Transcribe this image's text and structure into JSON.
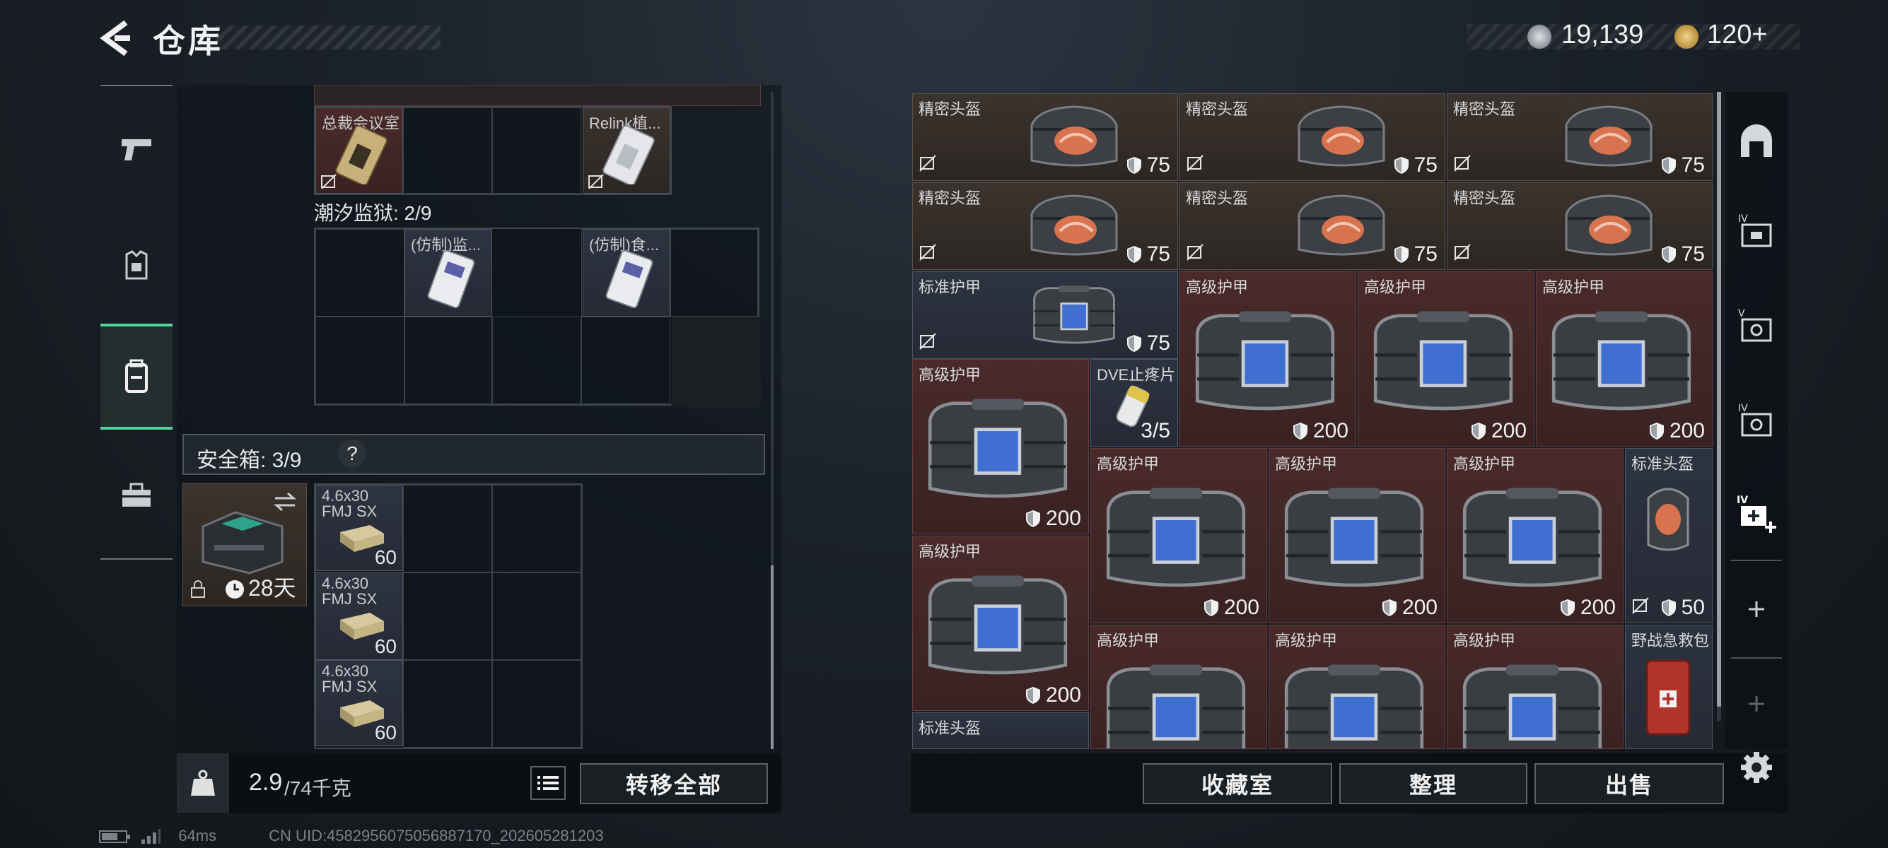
{
  "header": {
    "title": "仓库"
  },
  "currency": [
    {
      "icon": "silver-coin-icon",
      "value": "19,139"
    },
    {
      "icon": "gold-coin-icon",
      "value": "120+"
    }
  ],
  "sidebar": {
    "tabs": [
      {
        "icon": "pistol-icon",
        "active": false
      },
      {
        "icon": "armor-vest-icon",
        "active": false
      },
      {
        "icon": "backpack-icon",
        "active": true
      },
      {
        "icon": "toolbox-icon",
        "active": false
      }
    ]
  },
  "left": {
    "keys_grid": {
      "items": [
        {
          "name": "总裁会议室"
        },
        {
          "name": "Relink植..."
        }
      ]
    },
    "prison_label": "潮汐监狱: 2/9",
    "prison_items": [
      {
        "name": "(仿制)监..."
      },
      {
        "name": "(仿制)食..."
      }
    ],
    "safe_box": {
      "label": "安全箱: 3/9",
      "help": "?",
      "duration": "28天",
      "ammo": [
        {
          "name": "4.6x30 FMJ SX",
          "count": "60"
        },
        {
          "name": "4.6x30 FMJ SX",
          "count": "60"
        },
        {
          "name": "4.6x30 FMJ SX",
          "count": "60"
        }
      ]
    },
    "weight": {
      "current": "2.9",
      "max": "/74千克"
    },
    "transfer_all": "转移全部"
  },
  "right": {
    "items": [
      {
        "name": "精密头盔",
        "durability": "75",
        "tier": "brown"
      },
      {
        "name": "精密头盔",
        "durability": "75",
        "tier": "brown"
      },
      {
        "name": "精密头盔",
        "durability": "75",
        "tier": "brown"
      },
      {
        "name": "精密头盔",
        "durability": "75",
        "tier": "brown"
      },
      {
        "name": "精密头盔",
        "durability": "75",
        "tier": "brown"
      },
      {
        "name": "精密头盔",
        "durability": "75",
        "tier": "brown"
      },
      {
        "name": "标准护甲",
        "durability": "75",
        "tier": "blue"
      },
      {
        "name": "高级护甲",
        "durability": "200",
        "tier": "red"
      },
      {
        "name": "高级护甲",
        "durability": "200",
        "tier": "red"
      },
      {
        "name": "高级护甲",
        "durability": "200",
        "tier": "red"
      },
      {
        "name": "高级护甲",
        "durability": "200",
        "tier": "red"
      },
      {
        "name": "DVE止疼片",
        "durability": "3/5",
        "tier": "blue"
      },
      {
        "name": "高级护甲",
        "durability": "200",
        "tier": "red"
      },
      {
        "name": "高级护甲",
        "durability": "200",
        "tier": "red"
      },
      {
        "name": "高级护甲",
        "durability": "200",
        "tier": "red"
      },
      {
        "name": "标准头盔",
        "durability": "50",
        "tier": "blue"
      },
      {
        "name": "高级护甲",
        "durability": "200",
        "tier": "red"
      },
      {
        "name": "高级护甲",
        "durability": "",
        "tier": "red"
      },
      {
        "name": "高级护甲",
        "durability": "",
        "tier": "red"
      },
      {
        "name": "高级护甲",
        "durability": "",
        "tier": "red"
      },
      {
        "name": "野战急救包",
        "durability": "",
        "tier": "blue"
      },
      {
        "name": "标准头盔",
        "durability": "",
        "tier": "blue"
      }
    ],
    "buttons": {
      "collection": "收藏室",
      "organize": "整理",
      "sell": "出售"
    }
  },
  "right_sidebar": {
    "icons": [
      "safe-dome-icon",
      "folder-iv-icon",
      "case-v-icon",
      "case-iv-icon",
      "medkit-iv-add-icon",
      "plus-icon",
      "plus-icon",
      "gear-icon"
    ]
  },
  "footer": {
    "ping": "64ms",
    "uid": "CN UID:4582956075056887170_202605281203"
  },
  "colors": {
    "accent_green": "#54d39a",
    "rarity_brown": "#3b332d",
    "rarity_red": "#4a2a2a",
    "rarity_blue": "#2d3340"
  }
}
